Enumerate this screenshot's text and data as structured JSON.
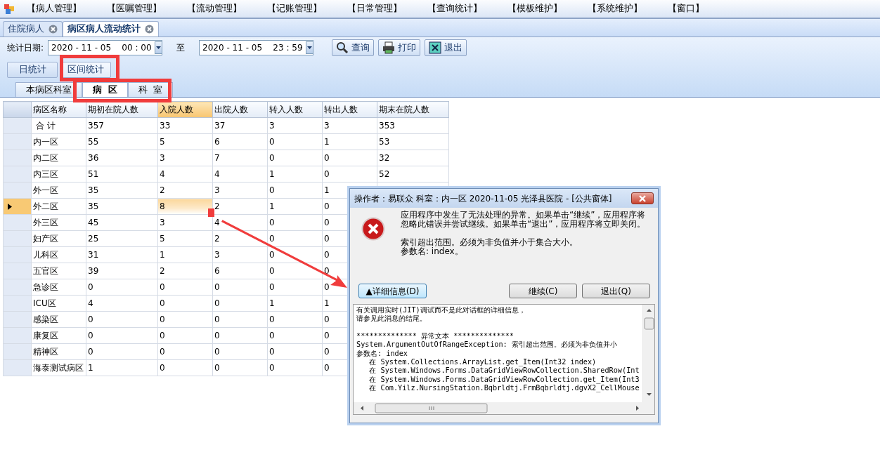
{
  "menu": [
    "【病人管理】",
    "【医嘱管理】",
    "【流动管理】",
    "【记账管理】",
    "【日常管理】",
    "【查询统计】",
    "【模板维护】",
    "【系统维护】",
    "【窗口】"
  ],
  "doc_tabs": [
    {
      "label": "住院病人",
      "selected": false
    },
    {
      "label": "病区病人流动统计",
      "selected": true
    }
  ],
  "toolbar": {
    "date_label": "统计日期:",
    "start": "2020 - 11 - 05    00 : 00",
    "to_label": "至",
    "end": "2020 - 11 - 05    23 : 59",
    "buttons": [
      {
        "kind": "search",
        "label": "查询"
      },
      {
        "kind": "print",
        "label": "打印"
      },
      {
        "kind": "exit",
        "label": "退出"
      }
    ]
  },
  "mode_tabs": [
    {
      "label": "日统计",
      "selected": false
    },
    {
      "label": "区间统计",
      "selected": true
    }
  ],
  "view_tabs": [
    {
      "label": "本病区科室",
      "selected": false
    },
    {
      "label": "病  区",
      "selected": true
    },
    {
      "label": "科  室",
      "selected": false
    }
  ],
  "table": {
    "columns": [
      {
        "label": "病区名称",
        "selected": false
      },
      {
        "label": "期初在院人数",
        "selected": false
      },
      {
        "label": "入院人数",
        "selected": true
      },
      {
        "label": "出院人数",
        "selected": false
      },
      {
        "label": "转入人数",
        "selected": false
      },
      {
        "label": "转出人数",
        "selected": false
      },
      {
        "label": "期末在院人数",
        "selected": false
      }
    ],
    "rows": [
      {
        "selected": false,
        "cells": [
          " 合 计",
          "357",
          "33",
          "37",
          "3",
          "3",
          "353"
        ]
      },
      {
        "selected": false,
        "cells": [
          "内一区",
          "55",
          "5",
          "6",
          "0",
          "1",
          "53"
        ]
      },
      {
        "selected": false,
        "cells": [
          "内二区",
          "36",
          "3",
          "7",
          "0",
          "0",
          "32"
        ]
      },
      {
        "selected": false,
        "cells": [
          "内三区",
          "51",
          "4",
          "4",
          "1",
          "0",
          "52"
        ]
      },
      {
        "selected": false,
        "cells": [
          "外一区",
          "35",
          "2",
          "3",
          "0",
          "1"
        ]
      },
      {
        "selected": true,
        "cells": [
          "外二区",
          "35",
          "8",
          "2",
          "1",
          "0"
        ]
      },
      {
        "selected": false,
        "cells": [
          "外三区",
          "45",
          "3",
          "4",
          "0",
          "0"
        ]
      },
      {
        "selected": false,
        "cells": [
          "妇产区",
          "25",
          "5",
          "2",
          "0",
          "0"
        ]
      },
      {
        "selected": false,
        "cells": [
          "儿科区",
          "31",
          "1",
          "3",
          "0",
          "0"
        ]
      },
      {
        "selected": false,
        "cells": [
          "五官区",
          "39",
          "2",
          "6",
          "0",
          "0"
        ]
      },
      {
        "selected": false,
        "cells": [
          "急诊区",
          "0",
          "0",
          "0",
          "0",
          "0"
        ]
      },
      {
        "selected": false,
        "cells": [
          "ICU区",
          "4",
          "0",
          "0",
          "1",
          "1"
        ]
      },
      {
        "selected": false,
        "cells": [
          "感染区",
          "0",
          "0",
          "0",
          "0",
          "0"
        ]
      },
      {
        "selected": false,
        "cells": [
          "康复区",
          "0",
          "0",
          "0",
          "0",
          "0"
        ]
      },
      {
        "selected": false,
        "cells": [
          "精神区",
          "0",
          "0",
          "0",
          "0",
          "0"
        ]
      },
      {
        "selected": false,
        "cells": [
          "海泰测试病区",
          "1",
          "0",
          "0",
          "0",
          "0"
        ]
      }
    ]
  },
  "dialog": {
    "title": "操作者：易联众  科室：内一区  2020-11-05  光泽县医院 - [公共窗体]",
    "message": "应用程序中发生了无法处理的异常。如果单击“继续”，应用程序将忽略此错误并尝试继续。如果单击“退出”，应用程序将立即关闭。",
    "error_lines": [
      "索引超出范围。必须为非负值并小于集合大小。",
      "参数名: index。"
    ],
    "details_button": "▲详细信息(D)",
    "continue_button": "继续(C)",
    "quit_button": "退出(Q)",
    "details": [
      [
        "有关调用实时(JIT)调试而不是此对话框的详细信息，",
        "请参见此消息的结尾。"
      ],
      [
        "************** 异常文本 **************",
        "System.ArgumentOutOfRangeException: 索引超出范围。必须为非负值并小",
        "参数名: index",
        "   在 System.Collections.ArrayList.get_Item(Int32 index)",
        "   在 System.Windows.Forms.DataGridViewRowCollection.SharedRow(Int",
        "   在 System.Windows.Forms.DataGridViewRowCollection.get_Item(Int3",
        "   在 Com.Yilz.NursingStation.Bqbrldtj.FrmBqbrldtj.dgvX2_CellMouse"
      ]
    ]
  }
}
